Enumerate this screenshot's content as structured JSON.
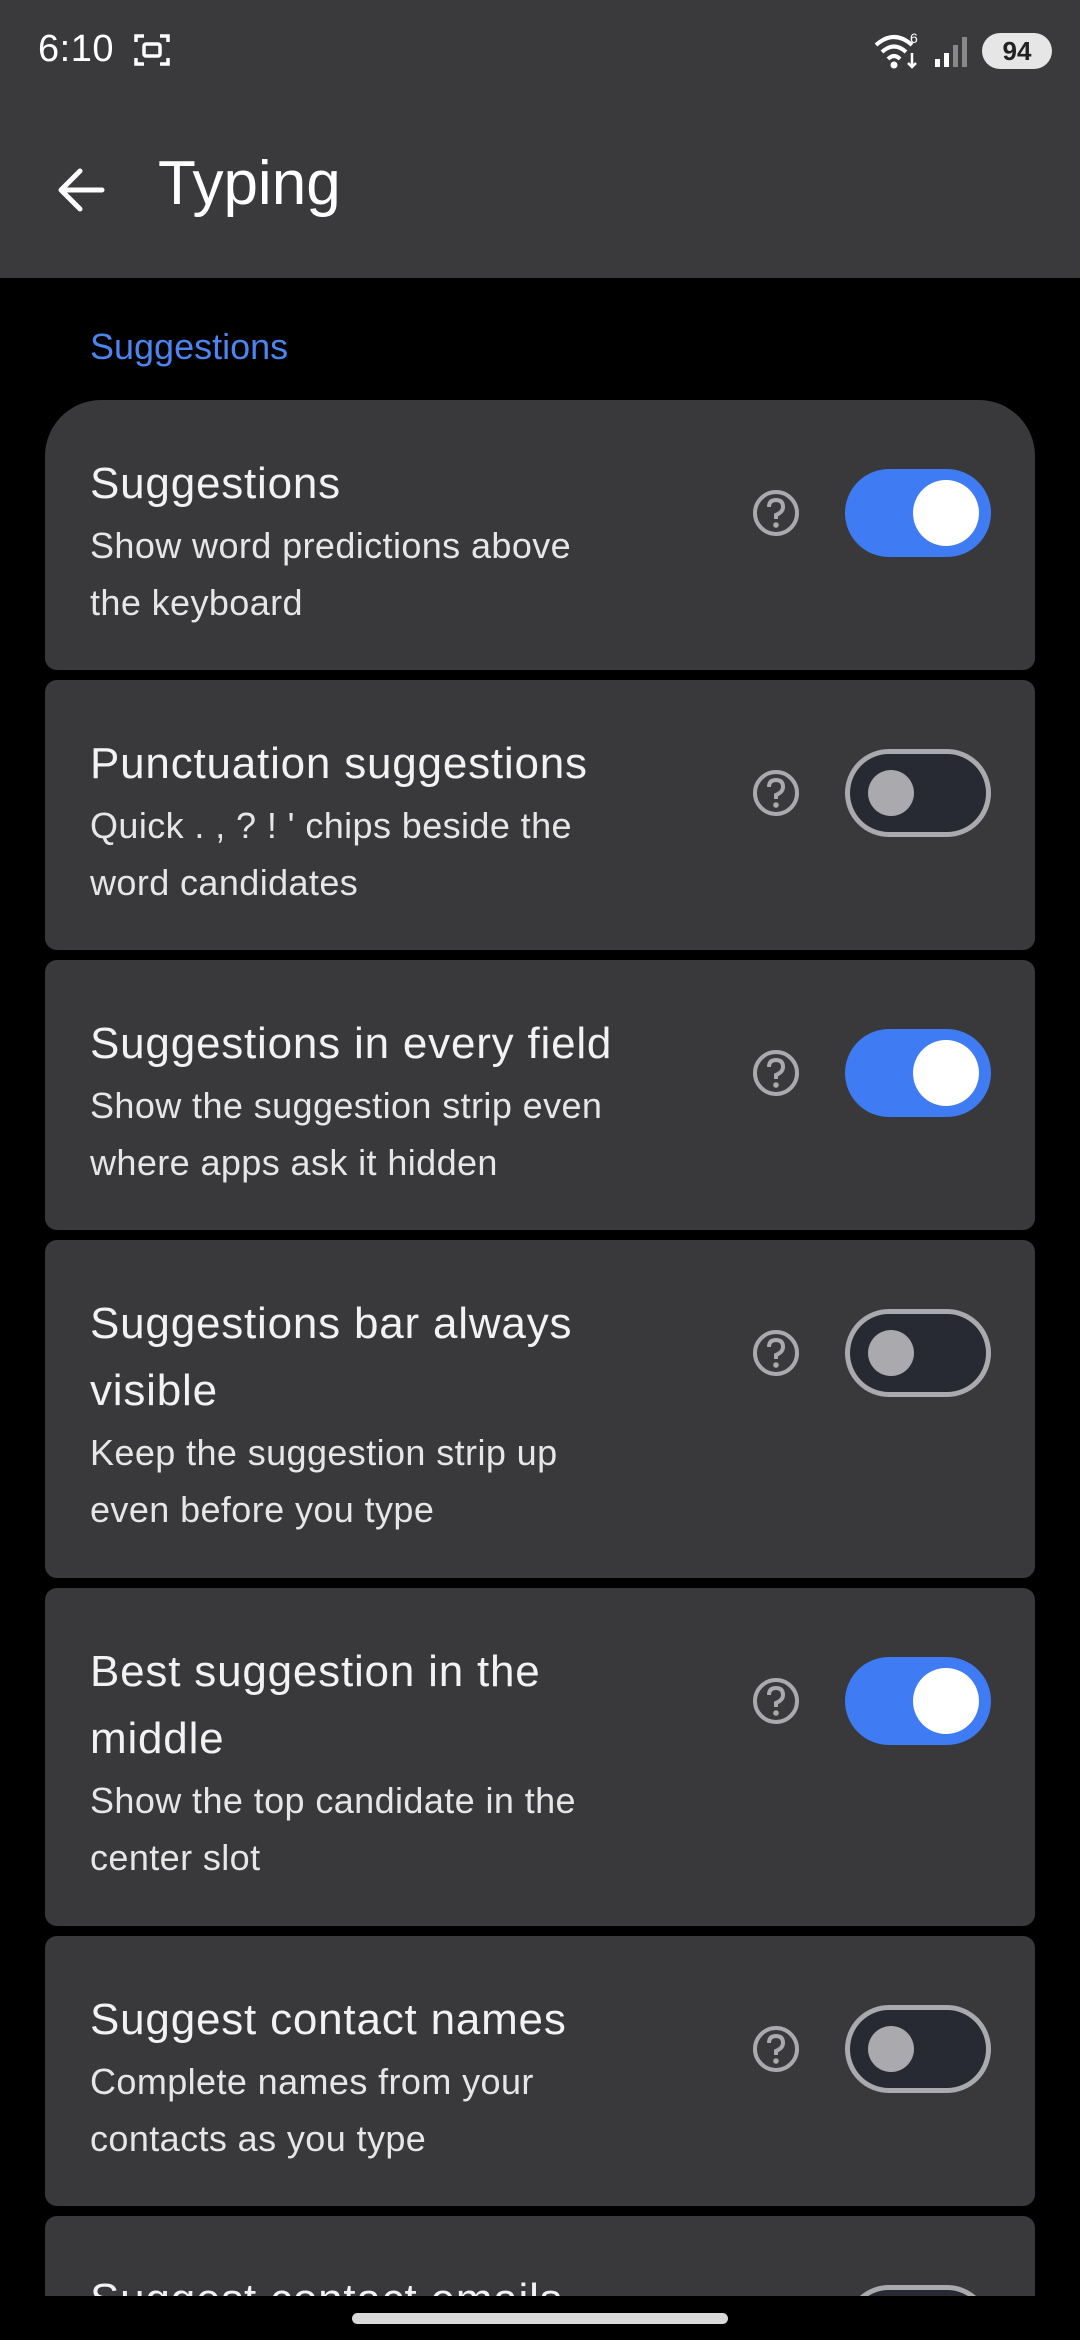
{
  "status_bar": {
    "time": "6:10",
    "network_badge": "6",
    "battery": "94",
    "icons": [
      "screenshot-icon",
      "wifi-icon",
      "signal-icon",
      "battery-icon"
    ]
  },
  "app_bar": {
    "title": "Typing",
    "back_icon": "arrow-back-icon"
  },
  "section": {
    "title": "Suggestions"
  },
  "colors": {
    "accent": "#4d85f0",
    "toggle_on": "#3f7bf2",
    "card": "#39393c",
    "appbar": "#3a3a3c",
    "background": "#000000"
  },
  "settings": [
    {
      "title": "Suggestions",
      "subtitle_line1": "Show word predictions above",
      "subtitle_line2": "the keyboard",
      "enabled": true
    },
    {
      "title": "Punctuation suggestions",
      "subtitle_line1": "Quick . , ? ! ' chips beside the",
      "subtitle_line2": "word candidates",
      "enabled": false
    },
    {
      "title": "Suggestions in every field",
      "subtitle_line1": "Show the suggestion strip even",
      "subtitle_line2": "where apps ask it hidden",
      "enabled": true
    },
    {
      "title_line1": "Suggestions bar always",
      "title_line2": "visible",
      "subtitle_line1": "Keep the suggestion strip up",
      "subtitle_line2": "even before you type",
      "enabled": false
    },
    {
      "title_line1": "Best suggestion in the",
      "title_line2": "middle",
      "subtitle_line1": "Show the top candidate in the",
      "subtitle_line2": "center slot",
      "enabled": true
    },
    {
      "title": "Suggest contact names",
      "subtitle_line1": "Complete names from your",
      "subtitle_line2": "contacts as you type",
      "enabled": false
    },
    {
      "title": "Suggest contact emails",
      "enabled": false
    }
  ]
}
